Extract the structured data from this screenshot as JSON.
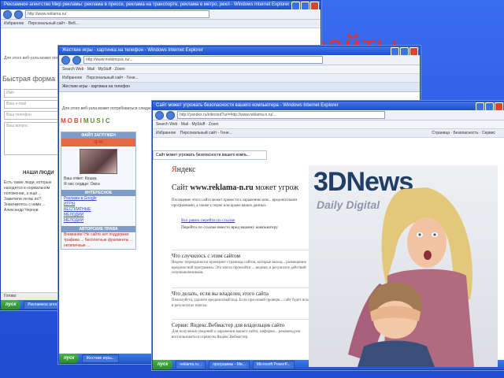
{
  "slide": {
    "title": "сайты"
  },
  "window1": {
    "title": "Рекламное агентство Мир рекламы: реклама в прессе, реклама на транспорте, реклама в метро, рекл - Windows Internet Explorer",
    "url": "http://www.reklama.ru/",
    "favorites_label": "Избранное",
    "tab_label": "Персональный сайт - Веб...",
    "notice": "Для этого веб-узла может потребоваться следующая надстройка: ...",
    "heading": "Быстрая форма зака",
    "fields": [
      "Имя",
      "Ваш e-mail",
      "Ваш телефон",
      "Ваш вопрос"
    ],
    "people_heading": "НАШИ ЛЮДИ",
    "people_text": "Есть такие люди, которые находятся в нормальном положении, а ещё ... Заметили ли вы их? Знакомитесь с ними ... Александр Чернов",
    "status": "Готово",
    "taskbar_start": "пуск",
    "taskbar_item": "Рекламное агентство..."
  },
  "window2": {
    "title": "Жесткие игры - картинка на телефон - Windows Internet Explorer",
    "url": "http://www.mobimusic.ru/...",
    "toolbar": "Search Web · Mail · MyStuff · Zoom",
    "favorites_label": "Избранное",
    "tab_label": "Персональный сайт - Гене...",
    "tab2_label": "Жесткие игры - картинка на телефон",
    "notice": "Для этого веб-узла может потребоваться следующая надстройка: ...",
    "logo_a": "MOBI",
    "logo_b": "MUSIC",
    "panel_head": "ФАЙЛ ЗАГРУЖЕН",
    "user_tag": "q-w",
    "rows": [
      "Ваш ответ: Кошка",
      "Я нас сердце: Омск"
    ],
    "interesting_head": "ИНТЕРЕСНОЕ",
    "interesting_links": [
      "Реклама в Google",
      "ИГРЫ",
      "БЕСПЛАТНЫЕ",
      "МЕЛОДИИ",
      "МЕЛОДИИ"
    ],
    "rights_head": "АВТОРСКИЕ ПРАВА",
    "warning": "Внимание! Не сайте нет поддержки трафика ... бесплатные фрагменты ... нетипичные ...",
    "taskbar_start": "пуск",
    "taskbar_item": "Жесткие игры..."
  },
  "window3": {
    "title": "Сайт может угрожать безопасности вашего компьютера - Windows Internet Explorer",
    "url": "http://yandex.ru/infected?url=http://www.reklama-n.ru/...",
    "toolbar": "Search Web · Mail · MyStuff · Zoom",
    "favorites_label": "Избранное",
    "tab_label": "Персональный сайт - Гене...",
    "tab2_label": "Сайт может угрожать безопасности вашего компь...",
    "page_tools": "Страница · Безопасность · Сервис",
    "logo_prefix": "Я",
    "logo_rest": "ндекс",
    "headline_pre": "Сайт ",
    "headline_bold": "www.reklama-n.ru",
    "headline_post": " может угрож",
    "intro": "Посещение этого сайта может привести к заражению ком... вредоносными программами, а также к порче или краже ваших данных.",
    "link1": "Все равно перейти по ссылке",
    "link2": "Перейти по ссылке вместо вред вашему компьютеру",
    "sections": [
      {
        "heading": "Что случилось с этим сайтом",
        "text": "Яндекс периодически проверяет страницы сайтов, которые выход... размещение вредоносной программы. Это могло произойти ... ведома, в результате действий злоумышленников."
      },
      {
        "heading": "Что делать, если вы владелец этого сайта",
        "text": "Пожалуйста, удалите вредоносный код. Если при новой проверк... сайт будет исключен в результатах поиска."
      },
      {
        "heading": "Сервис Яндекс.Вебмастер для владельцев сайто",
        "text": "Для получения сведений о заражении вашего сайта, информа... рекомендуем воспользоваться сервисом Яндекс.Вебмастер."
      }
    ],
    "taskbar_start": "пуск",
    "taskbar_items": [
      "reklama.ru...",
      "программы - Ми...",
      "Microsoft PowerP..."
    ]
  },
  "photo": {
    "logo": "3DNews",
    "subtitle": "Daily Digital"
  },
  "colors": {
    "slide_bg": "#2f62e6",
    "title_text": "#e03030",
    "xp_titlebar": "#1c4dd0",
    "start_button": "#2e8a32"
  }
}
